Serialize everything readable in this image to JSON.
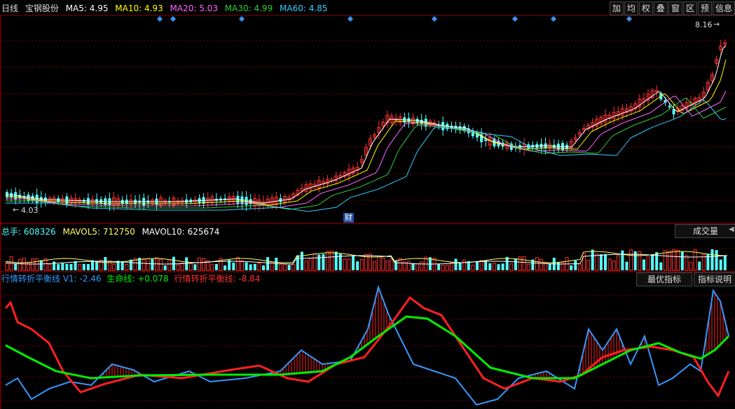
{
  "main": {
    "period_label": "日线",
    "stock_name": "宝钢股份",
    "ma": [
      {
        "label": "MA5: 4.95",
        "color": "#ffffff"
      },
      {
        "label": "MA10: 4.93",
        "color": "#ffff00"
      },
      {
        "label": "MA20: 5.03",
        "color": "#ff66ff"
      },
      {
        "label": "MA30: 4.99",
        "color": "#33cc33"
      },
      {
        "label": "MA60: 4.85",
        "color": "#33ccff"
      }
    ],
    "high_label": "8.16",
    "low_label": "4.03",
    "finance_marker": "财"
  },
  "toolbar": {
    "buttons": [
      "加",
      "均",
      "权",
      "叠",
      "窗",
      "区",
      "预",
      "信息"
    ]
  },
  "volume": {
    "total_label": "总手: 608326",
    "mavol5_label": "MAVOL5: 712750",
    "mavol10_label": "MAVOL10: 625674",
    "panel_name": "成交量"
  },
  "indicator": {
    "v1_label": "行情转折平衡线 V1: -2.46",
    "life_label": "生命线: +0.078",
    "balance_label": "行情转折平衡线: -8.84",
    "best_button": "最优指标",
    "explain_button": "指标说明"
  },
  "colors": {
    "up": "#ff3232",
    "down": "#54ffff",
    "grid": "#8b0000",
    "blue_line": "#3399ff",
    "green_line": "#00ee00",
    "red_line": "#ff2020"
  }
}
